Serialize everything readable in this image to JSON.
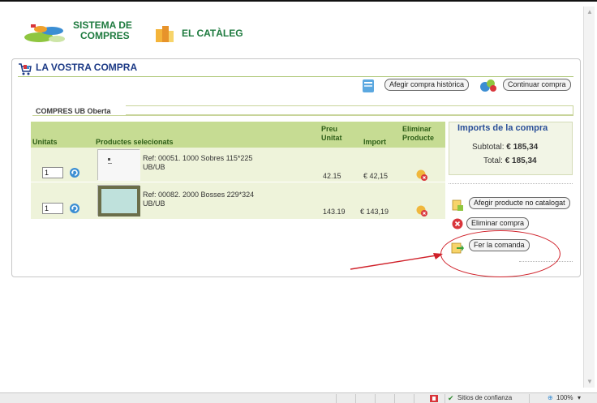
{
  "header": {
    "logo1_line1": "SISTEMA DE",
    "logo1_line2": "COMPRES",
    "logo2_text": "EL CATÀLEG"
  },
  "panel": {
    "title": "LA VOSTRA COMPRA",
    "add_historic_label": "Afegir compra històrica",
    "continue_label": "Continuar compra",
    "tab_label": "COMPRES UB Oberta"
  },
  "table": {
    "headers": {
      "units": "Unitats",
      "products": "Productes selecionats",
      "price_unit_1": "Preu",
      "price_unit_2": "Unitat",
      "import": "Import",
      "delete_1": "Eliminar",
      "delete_2": "Producte"
    },
    "rows": [
      {
        "qty": "1",
        "ref": "Ref: 00051. 1000 Sobres 115*225",
        "sub": "UB/UB",
        "price": "42.15",
        "import": "€ 42,15"
      },
      {
        "qty": "1",
        "ref": "Ref: 00082. 2000 Bosses 229*324",
        "sub": "UB/UB",
        "price": "143.19",
        "import": "€ 143,19"
      }
    ]
  },
  "totals": {
    "title": "Imports de la compra",
    "subtotal_label": "Subtotal:",
    "subtotal_value": "€ 185,34",
    "total_label": "Total:",
    "total_value": "€ 185,34"
  },
  "actions": {
    "add_product_label": "Afegir producte no catalogat",
    "delete_purchase_label": "Eliminar compra",
    "place_order_label": "Fer la comanda"
  },
  "statusbar": {
    "zone": "Sitios de confianza",
    "zoom": "100%"
  },
  "colors": {
    "table_header": "#c6dc93",
    "row_bg": "#eef3da",
    "title_blue": "#1c3a86",
    "highlight_red": "#d0212a"
  }
}
